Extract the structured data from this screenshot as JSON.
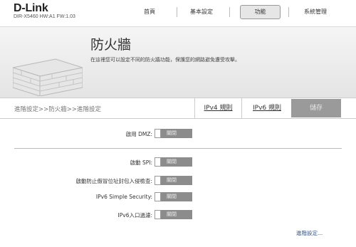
{
  "header": {
    "logo": "D-Link",
    "model": "DIR-X5460 HW:A1 FW:1.03",
    "nav": [
      "首頁",
      "基本設定",
      "功能",
      "系統管理"
    ],
    "active_nav": "功能"
  },
  "banner": {
    "title": "防火牆",
    "description": "在這裡您可以設定不同的防火牆功能，保護您的網路避免遭受攻擊。"
  },
  "tabs": {
    "breadcrumb": "進階設定>>防火牆>>進階設定",
    "ipv4": "IPv4 規則",
    "ipv6": "IPv6 規則",
    "save": "儲存"
  },
  "settings": {
    "dmz": {
      "label": "啟用 DMZ:",
      "state": "關閉"
    },
    "spi": {
      "label": "啟動 SPI:",
      "state": "關閉"
    },
    "antispoof": {
      "label": "啟動防止假冒位址封包入侵檢查:",
      "state": "關閉"
    },
    "ipv6_simple": {
      "label": "IPv6 Simple Security:",
      "state": "關閉"
    },
    "ipv6_ingress": {
      "label": "IPv6入口過濾:",
      "state": "關閉"
    }
  },
  "advanced_link": "進階設定..."
}
